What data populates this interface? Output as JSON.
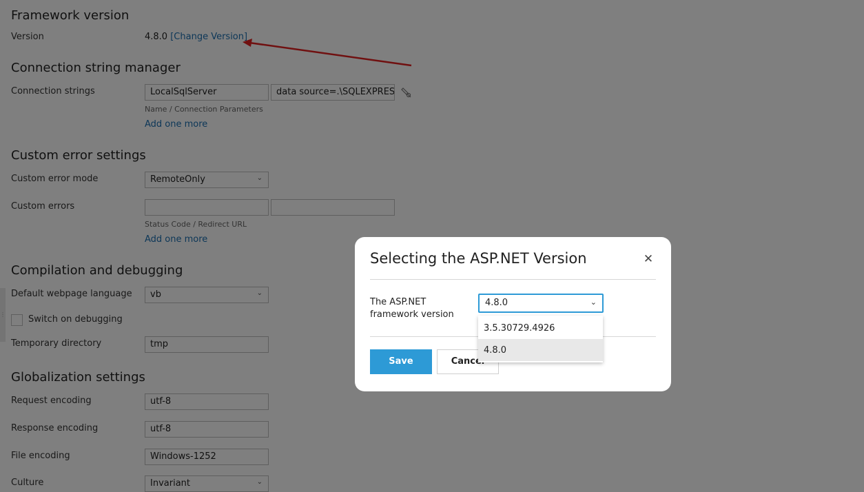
{
  "framework": {
    "title": "Framework version",
    "version_label": "Version",
    "version_value": "4.8.0",
    "change_link": "[Change Version]"
  },
  "connection": {
    "title": "Connection string manager",
    "label": "Connection strings",
    "name_value": "LocalSqlServer",
    "params_value": "data source=.\\SQLEXPRESS;I",
    "hint": "Name / Connection Parameters",
    "add_more": "Add one more"
  },
  "custom_error": {
    "title": "Custom error settings",
    "mode_label": "Custom error mode",
    "mode_value": "RemoteOnly",
    "errors_label": "Custom errors",
    "status_value": "",
    "redirect_value": "",
    "hint": "Status Code / Redirect URL",
    "add_more": "Add one more"
  },
  "compilation": {
    "title": "Compilation and debugging",
    "language_label": "Default webpage language",
    "language_value": "vb",
    "debug_label": "Switch on debugging",
    "debug_checked": false,
    "tempdir_label": "Temporary directory",
    "tempdir_value": "tmp"
  },
  "globalization": {
    "title": "Globalization settings",
    "request_label": "Request encoding",
    "request_value": "utf-8",
    "response_label": "Response encoding",
    "response_value": "utf-8",
    "file_label": "File encoding",
    "file_value": "Windows-1252",
    "culture_label": "Culture",
    "culture_value": "Invariant"
  },
  "dialog": {
    "title": "Selecting the ASP.NET Version",
    "field_label": "The ASP.NET framework version",
    "selected": "4.8.0",
    "options": [
      "3.5.30729.4926",
      "4.8.0"
    ],
    "save": "Save",
    "cancel": "Cancel"
  },
  "colors": {
    "accent": "#2d9ad6",
    "link": "#1a6fb0",
    "annotation_arrow": "#e02020"
  }
}
